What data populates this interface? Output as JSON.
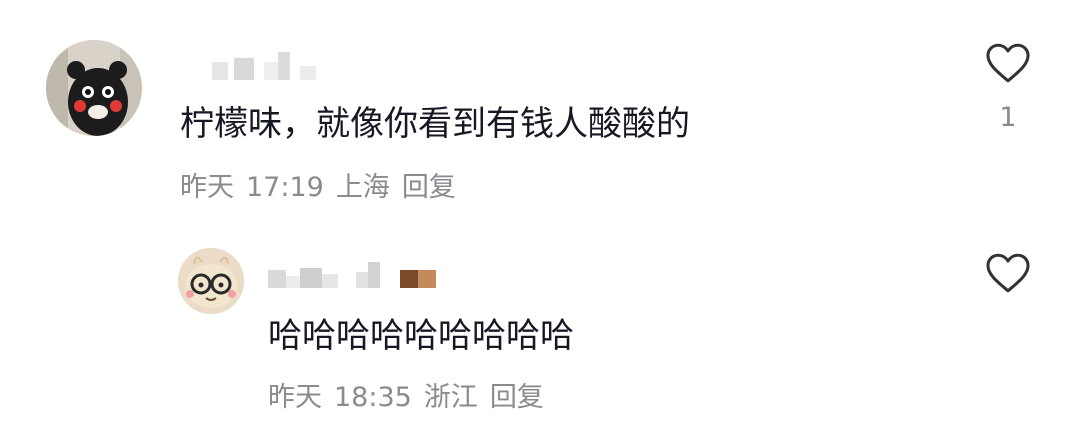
{
  "comments": [
    {
      "text": "柠檬味，就像你看到有钱人酸酸的",
      "date": "昨天",
      "time": "17:19",
      "location": "上海",
      "reply_label": "回复",
      "like_count": "1",
      "avatar_icon": "bear-mascot-avatar"
    },
    {
      "text": "哈哈哈哈哈哈哈哈哈",
      "date": "昨天",
      "time": "18:35",
      "location": "浙江",
      "reply_label": "回复",
      "like_count": "",
      "avatar_icon": "glasses-character-avatar"
    }
  ],
  "icons": {
    "like": "heart-outline-icon"
  },
  "colors": {
    "text": "#161823",
    "meta": "#8a8b91",
    "icon": "#333333"
  }
}
